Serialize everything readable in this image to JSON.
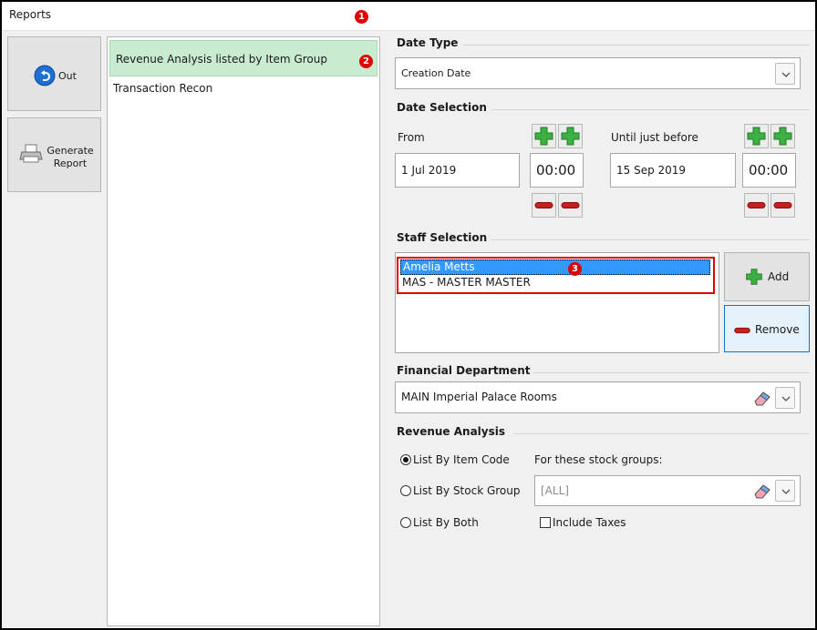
{
  "window": {
    "title": "Reports"
  },
  "markers": [
    "1",
    "2",
    "3"
  ],
  "sidebar": {
    "out_label": "Out",
    "generate_label_1": "Generate",
    "generate_label_2": "Report"
  },
  "reports": [
    {
      "label": "Revenue Analysis listed by Item Group",
      "selected": true
    },
    {
      "label": "Transaction Recon",
      "selected": false
    }
  ],
  "date_type": {
    "title": "Date Type",
    "value": "Creation Date"
  },
  "date_selection": {
    "title": "Date Selection",
    "from_label": "From",
    "from_date": "1 Jul 2019",
    "from_time": "00:00",
    "until_label": "Until just before",
    "until_date": "15 Sep 2019",
    "until_time": "00:00"
  },
  "staff_selection": {
    "title": "Staff Selection",
    "items": [
      "Amelia Metts",
      "MAS - MASTER MASTER"
    ],
    "add_label": "Add",
    "remove_label": "Remove"
  },
  "financial_department": {
    "title": "Financial Department",
    "value": "MAIN Imperial Palace Rooms"
  },
  "revenue_analysis": {
    "title": "Revenue Analysis",
    "options": [
      "List By Item Code",
      "List By Stock Group",
      "List By Both"
    ],
    "selected_index": 0,
    "stock_groups_label": "For these stock groups:",
    "stock_groups_value": "[ALL]",
    "include_taxes_label": "Include Taxes",
    "include_taxes_checked": false
  },
  "colors": {
    "accent_red": "#e00000",
    "selected_row": "#c9ecd0",
    "selection_blue": "#3399ff",
    "plus_green": "#3cb043",
    "minus_red": "#c81e1e"
  }
}
